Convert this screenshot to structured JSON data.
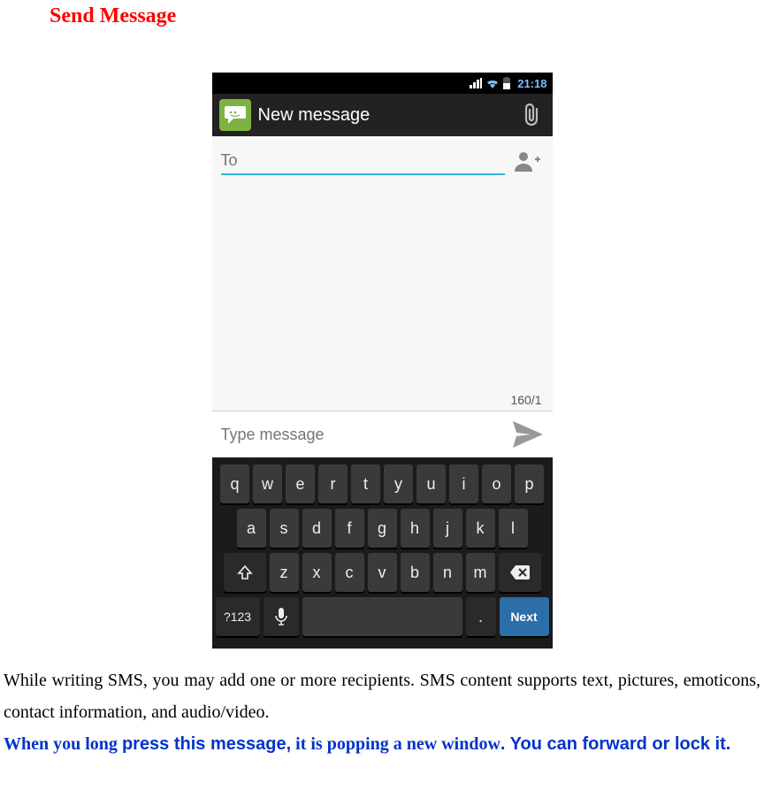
{
  "title": "Send Message",
  "statusbar": {
    "time": "21:18"
  },
  "appbar": {
    "title": "New message"
  },
  "to": {
    "placeholder": "To"
  },
  "counter": "160/1",
  "compose": {
    "placeholder": "Type message"
  },
  "keyboard": {
    "row1": [
      "q",
      "w",
      "e",
      "r",
      "t",
      "y",
      "u",
      "i",
      "o",
      "p"
    ],
    "row2": [
      "a",
      "s",
      "d",
      "f",
      "g",
      "h",
      "j",
      "k",
      "l"
    ],
    "row3": [
      "z",
      "x",
      "c",
      "v",
      "b",
      "n",
      "m"
    ],
    "sym": "?123",
    "dot": ".",
    "next": "Next"
  },
  "paragraph1": "While writing SMS, you may add one or more recipients. SMS content supports text, pictures, emoticons, contact information, and audio/video.",
  "paragraph2a": "When you long ",
  "paragraph2b": "press this message,",
  "paragraph2c": " it is popping a new window",
  "paragraph2d": ". You can forward or lock it."
}
